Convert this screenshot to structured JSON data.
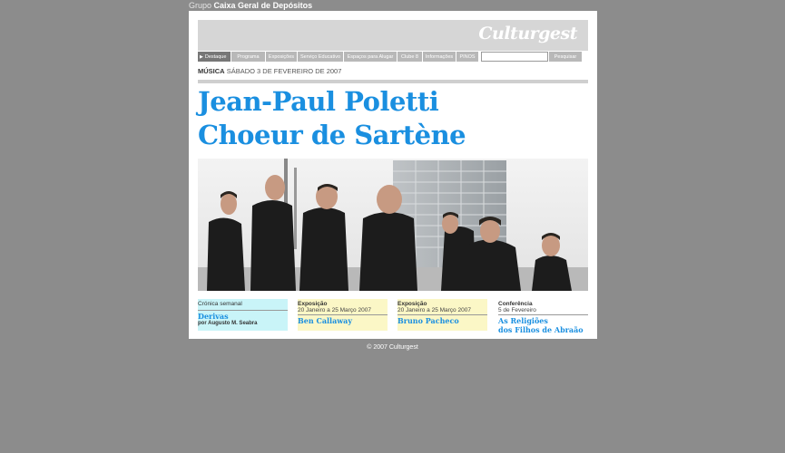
{
  "group_line": {
    "prefix": "Grupo",
    "name": "Caixa Geral de Depósitos"
  },
  "brand": {
    "logo": "Culturgest"
  },
  "nav": {
    "items": [
      "Destaque",
      "Programa",
      "Exposições",
      "Serviço Educativo",
      "Espaços para Alugar",
      "Clube 8",
      "Informações",
      "PINOS"
    ],
    "search_button": "Pesquisar",
    "search_value": ""
  },
  "event": {
    "category": "MÚSICA",
    "date": "SÁBADO 3 DE FEVEREIRO DE 2007",
    "title_line1": "Jean-Paul Poletti",
    "title_line2": "Choeur de Sartène"
  },
  "cards": [
    {
      "label": "Crónica semanal",
      "sub": "",
      "title": "Derivas",
      "title2": "",
      "author": "por Augusto M. Seabra",
      "bg": "#c9f4f8"
    },
    {
      "label": "Exposição",
      "sub": "20 Janeiro a 25 Março 2007",
      "title": "Ben Callaway",
      "title2": "",
      "author": "",
      "bg": "#fbf7c6"
    },
    {
      "label": "Exposição",
      "sub": "20 Janeiro a 25 Março 2007",
      "title": "Bruno Pacheco",
      "title2": "",
      "author": "",
      "bg": "#fbf7c6"
    },
    {
      "label": "Conferência",
      "sub": "5 de Fevereiro",
      "title": "As Religiões",
      "title2": "dos Filhos de Abraão",
      "author": "",
      "bg": "#ffffff"
    }
  ],
  "footer": {
    "copyright": "© 2007 Culturgest"
  },
  "colors": {
    "page_bg": "#8c8c8c",
    "accent_blue": "#1a8fe0",
    "nav_tab": "#b8b8b8"
  }
}
